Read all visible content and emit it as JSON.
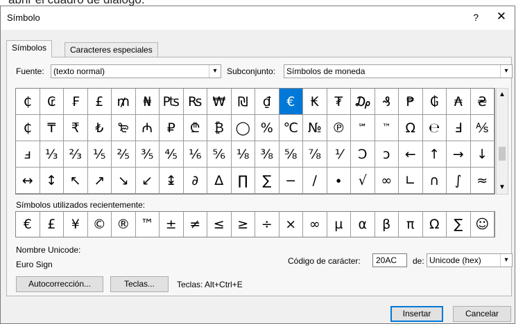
{
  "above_text": "abrir el cuadro de diálogo.",
  "window": {
    "title": "Símbolo",
    "help": "?",
    "close": "✕"
  },
  "tabs": {
    "symbols": "Símbolos",
    "special": "Caracteres especiales"
  },
  "font": {
    "label": "Fuente:",
    "value": "(texto normal)"
  },
  "subset": {
    "label": "Subconjunto:",
    "value": "Símbolos de moneda"
  },
  "symbol_grid": {
    "selected": "€",
    "rows": [
      [
        "₵",
        "₢",
        "₣",
        "£",
        "₥",
        "₦",
        "₧",
        "₨",
        "₩",
        "₪",
        "₫",
        "€",
        "₭",
        "₮",
        "₯",
        "₰",
        "₱",
        "₲",
        "₳",
        "₴"
      ],
      [
        "₵",
        "₸",
        "₹",
        "₺",
        "₻",
        "₼",
        "₽",
        "₾",
        "₿",
        "◯",
        "%",
        "℃",
        "№",
        "℗",
        "℠",
        "™",
        "Ω",
        "℮",
        "Ⅎ",
        "⅍"
      ],
      [
        "ⅎ",
        "⅓",
        "⅔",
        "⅕",
        "⅖",
        "⅗",
        "⅘",
        "⅙",
        "⅚",
        "⅛",
        "⅜",
        "⅝",
        "⅞",
        "⅟",
        "Ↄ",
        "ↄ",
        "←",
        "↑",
        "→",
        "↓"
      ],
      [
        "↔",
        "↕",
        "↖",
        "↗",
        "↘",
        "↙",
        "↨",
        "∂",
        "∆",
        "∏",
        "∑",
        "−",
        "∕",
        "∙",
        "√",
        "∞",
        "∟",
        "∩",
        "∫",
        "≈"
      ]
    ]
  },
  "recent": {
    "label": "Símbolos utilizados recientemente:",
    "symbols": [
      "€",
      "£",
      "¥",
      "©",
      "®",
      "™",
      "±",
      "≠",
      "≤",
      "≥",
      "÷",
      "×",
      "∞",
      "µ",
      "α",
      "β",
      "π",
      "Ω",
      "∑",
      "☺"
    ]
  },
  "unicode": {
    "name_label": "Nombre Unicode:",
    "name_value": "Euro Sign",
    "code_label": "Código de carácter:",
    "code_value": "20AC",
    "from_label": "de:",
    "from_value": "Unicode (hex)"
  },
  "buttons": {
    "autocorrect": "Autocorrección...",
    "keys": "Teclas...",
    "shortcut": "Teclas: Alt+Ctrl+E",
    "insert": "Insertar",
    "cancel": "Cancelar"
  },
  "icons": {
    "dropdown": "▾",
    "scroll_up": "▲",
    "scroll_down": "▼"
  }
}
